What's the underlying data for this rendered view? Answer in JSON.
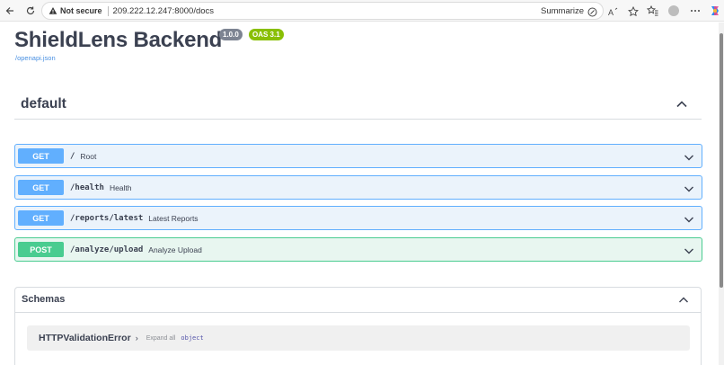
{
  "browser": {
    "not_secure": "Not secure",
    "url": "209.222.12.247:8000/docs",
    "summarize": "Summarize"
  },
  "header": {
    "title": "ShieldLens Backend",
    "version": "1.0.0",
    "oas": "OAS 3.1",
    "openapi_link": "/openapi.json"
  },
  "section": {
    "title": "default"
  },
  "operations": [
    {
      "method": "GET",
      "path": "/",
      "summary": "Root"
    },
    {
      "method": "GET",
      "path": "/health",
      "summary": "Health"
    },
    {
      "method": "GET",
      "path": "/reports/latest",
      "summary": "Latest Reports"
    },
    {
      "method": "POST",
      "path": "/analyze/upload",
      "summary": "Analyze Upload"
    }
  ],
  "schemas": {
    "title": "Schemas",
    "models": [
      {
        "name": "HTTPValidationError",
        "arrow": "›",
        "expand": "Expand all",
        "type": "object"
      }
    ]
  },
  "colors": {
    "get": "#61affe",
    "post": "#49cc90",
    "link": "#4990e2"
  }
}
